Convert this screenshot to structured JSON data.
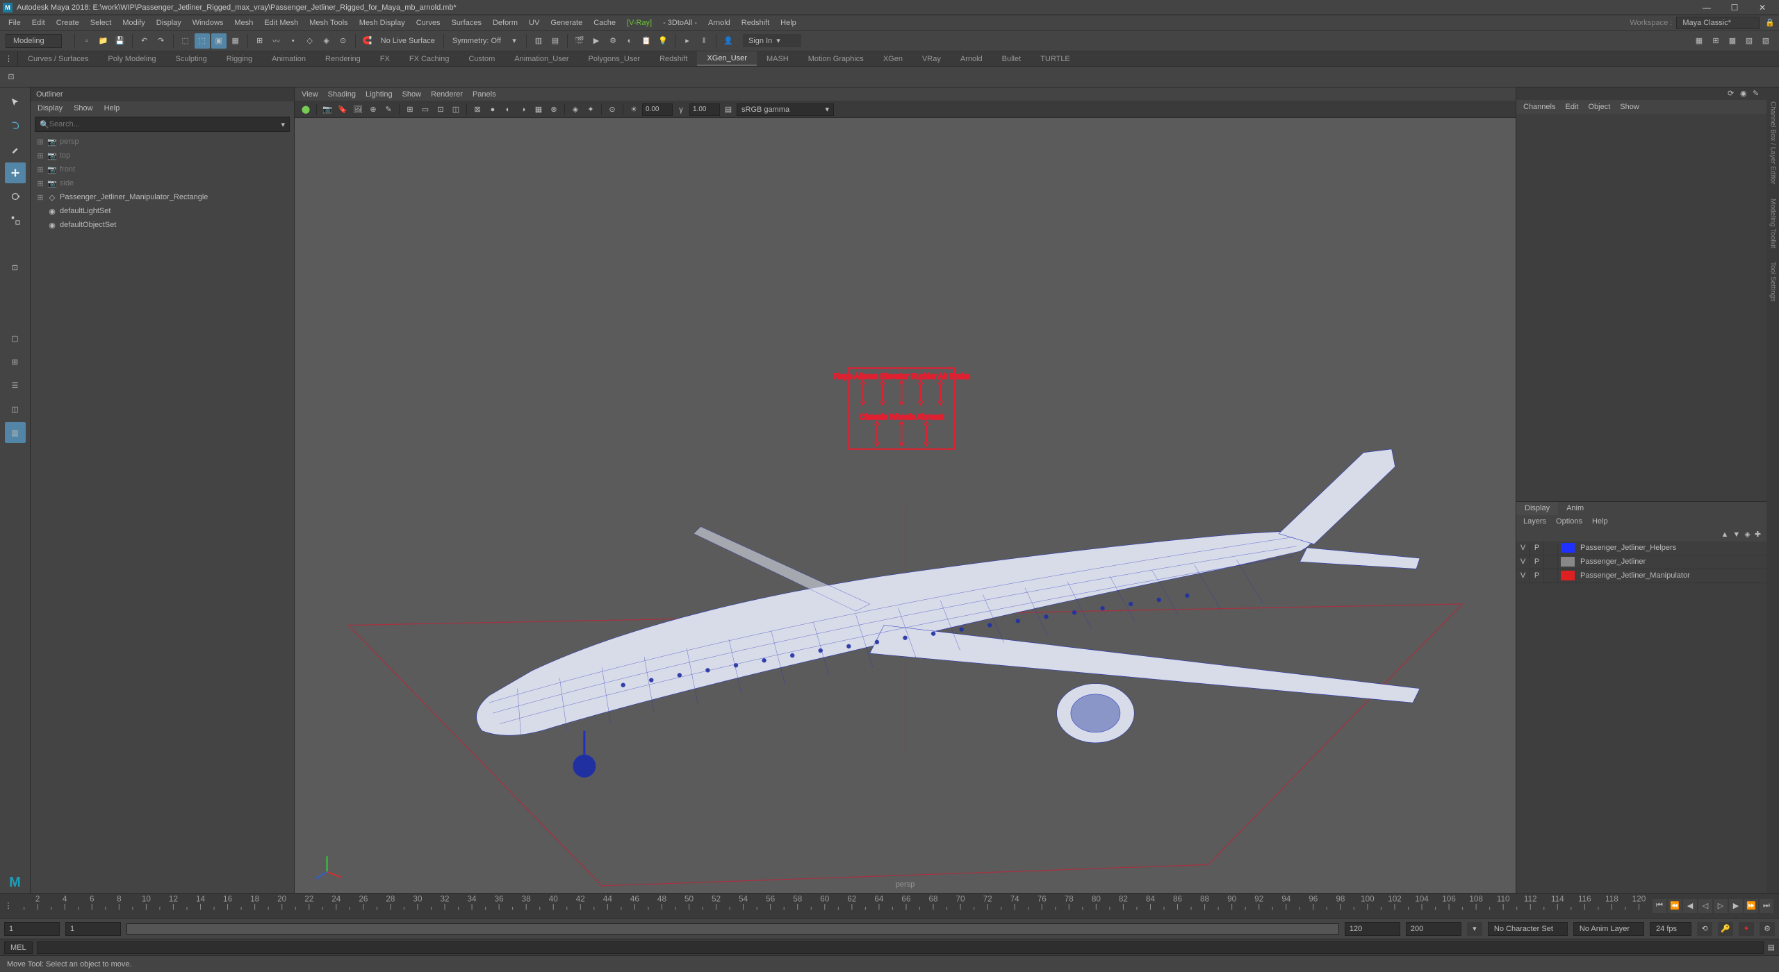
{
  "title": "Autodesk Maya 2018: E:\\work\\WIP\\Passenger_Jetliner_Rigged_max_vray\\Passenger_Jetliner_Rigged_for_Maya_mb_arnold.mb*",
  "app_icon": "M",
  "menus": [
    "File",
    "Edit",
    "Create",
    "Select",
    "Modify",
    "Display",
    "Windows",
    "Mesh",
    "Edit Mesh",
    "Mesh Tools",
    "Mesh Display",
    "Curves",
    "Surfaces",
    "Deform",
    "UV",
    "Generate",
    "Cache"
  ],
  "menus_plugins": [
    "[V-Ray]",
    "- 3DtoAll -",
    "Arnold",
    "Redshift",
    "Help"
  ],
  "workspace_label": "Workspace :",
  "workspace_value": "Maya Classic*",
  "mode_selector": "Modeling",
  "status_text": [
    "No Live Surface",
    "Symmetry: Off"
  ],
  "signin": "Sign In",
  "shelf_tabs": [
    "Curves / Surfaces",
    "Poly Modeling",
    "Sculpting",
    "Rigging",
    "Animation",
    "Rendering",
    "FX",
    "FX Caching",
    "Custom",
    "Animation_User",
    "Polygons_User",
    "Redshift",
    "XGen_User",
    "MASH",
    "Motion Graphics",
    "XGen",
    "VRay",
    "Arnold",
    "Bullet",
    "TURTLE"
  ],
  "shelf_active": "XGen_User",
  "outliner": {
    "title": "Outliner",
    "menus": [
      "Display",
      "Show",
      "Help"
    ],
    "search_placeholder": "Search...",
    "items": [
      {
        "icon": "cam",
        "label": "persp",
        "dim": true,
        "exp": "+"
      },
      {
        "icon": "cam",
        "label": "top",
        "dim": true,
        "exp": "+"
      },
      {
        "icon": "cam",
        "label": "front",
        "dim": true,
        "exp": "+"
      },
      {
        "icon": "cam",
        "label": "side",
        "dim": true,
        "exp": "+"
      },
      {
        "icon": "grp",
        "label": "Passenger_Jetliner_Manipulator_Rectangle",
        "dim": false,
        "exp": "+"
      },
      {
        "icon": "set",
        "label": "defaultLightSet",
        "dim": false,
        "exp": ""
      },
      {
        "icon": "set",
        "label": "defaultObjectSet",
        "dim": false,
        "exp": ""
      }
    ]
  },
  "viewport": {
    "menus": [
      "View",
      "Shading",
      "Lighting",
      "Show",
      "Renderer",
      "Panels"
    ],
    "num1": "0.00",
    "num2": "1.00",
    "gamma": "sRGB gamma",
    "camera": "persp"
  },
  "channelbox": {
    "menus": [
      "Channels",
      "Edit",
      "Object",
      "Show"
    ],
    "display_tab": "Display",
    "anim_tab": "Anim",
    "layer_menus": [
      "Layers",
      "Options",
      "Help"
    ],
    "layers": [
      {
        "v": "V",
        "p": "P",
        "color": "#2030ff",
        "name": "Passenger_Jetliner_Helpers"
      },
      {
        "v": "V",
        "p": "P",
        "color": "#888888",
        "name": "Passenger_Jetliner"
      },
      {
        "v": "V",
        "p": "P",
        "color": "#e02020",
        "name": "Passenger_Jetliner_Manipulator"
      }
    ]
  },
  "sidebar_strips": [
    "Channel Box / Layer Editor",
    "Modeling Toolkit",
    "Tool Settings"
  ],
  "timeline": {
    "start": 1,
    "end": 120
  },
  "range": {
    "f1": "1",
    "f2": "1",
    "f3": "120",
    "f4": "200",
    "charset": "No Character Set",
    "animlayer": "No Anim Layer",
    "fps": "24 fps"
  },
  "cmd": "MEL",
  "helpline": "Move Tool: Select an object to move."
}
